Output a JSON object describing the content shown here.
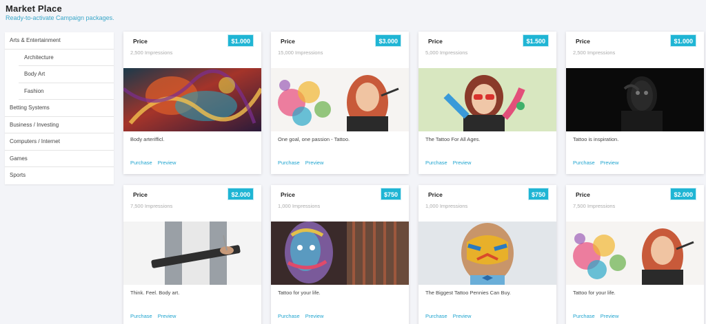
{
  "header": {
    "title": "Market Place",
    "subtitle": "Ready-to-activate Campaign packages."
  },
  "sidebar": {
    "items": [
      {
        "label": "Arts & Entertainment",
        "level": 0
      },
      {
        "label": "Architecture",
        "level": 1
      },
      {
        "label": "Body Art",
        "level": 1
      },
      {
        "label": "Fashion",
        "level": 1
      },
      {
        "label": "Betting Systems",
        "level": 0
      },
      {
        "label": "Business / Investing",
        "level": 0
      },
      {
        "label": "Computers / Internet",
        "level": 0
      },
      {
        "label": "Games",
        "level": 0
      },
      {
        "label": "Sports",
        "level": 0
      }
    ]
  },
  "cards": [
    {
      "price_label": "Price",
      "price": "$1.000",
      "impressions": "2,500 Impressions",
      "description": "Body arterifficl.",
      "purchase": "Purchase",
      "preview": "Preview",
      "image": "abstract-painted-face"
    },
    {
      "price_label": "Price",
      "price": "$3.000",
      "impressions": "15,000 Impressions",
      "description": "One goal, one passion - Tattoo.",
      "purchase": "Purchase",
      "preview": "Preview",
      "image": "woman-color-splash"
    },
    {
      "price_label": "Price",
      "price": "$1.500",
      "impressions": "5,000 Impressions",
      "description": "The Tattoo For All Ages.",
      "purchase": "Purchase",
      "preview": "Preview",
      "image": "woman-sunglasses-tattoo"
    },
    {
      "price_label": "Price",
      "price": "$1.000",
      "impressions": "2,500 Impressions",
      "description": "Tattoo is inspiration.",
      "purchase": "Purchase",
      "preview": "Preview",
      "image": "dark-body-paint"
    },
    {
      "price_label": "Price",
      "price": "$2.000",
      "impressions": "7,500 Impressions",
      "description": "Think. Feel. Body art.",
      "purchase": "Purchase",
      "preview": "Preview",
      "image": "person-with-folder"
    },
    {
      "price_label": "Price",
      "price": "$750",
      "impressions": "1,000 Impressions",
      "description": "Tattoo for your life.",
      "purchase": "Purchase",
      "preview": "Preview",
      "image": "painted-face-colorful"
    },
    {
      "price_label": "Price",
      "price": "$750",
      "impressions": "1,000 Impressions",
      "description": "The Biggest Tattoo Pennies Can Buy.",
      "purchase": "Purchase",
      "preview": "Preview",
      "image": "boy-tiger-facepaint"
    },
    {
      "price_label": "Price",
      "price": "$2.000",
      "impressions": "7,500 Impressions",
      "description": "Tattoo for your life.",
      "purchase": "Purchase",
      "preview": "Preview",
      "image": "woman-color-splash"
    }
  ]
}
